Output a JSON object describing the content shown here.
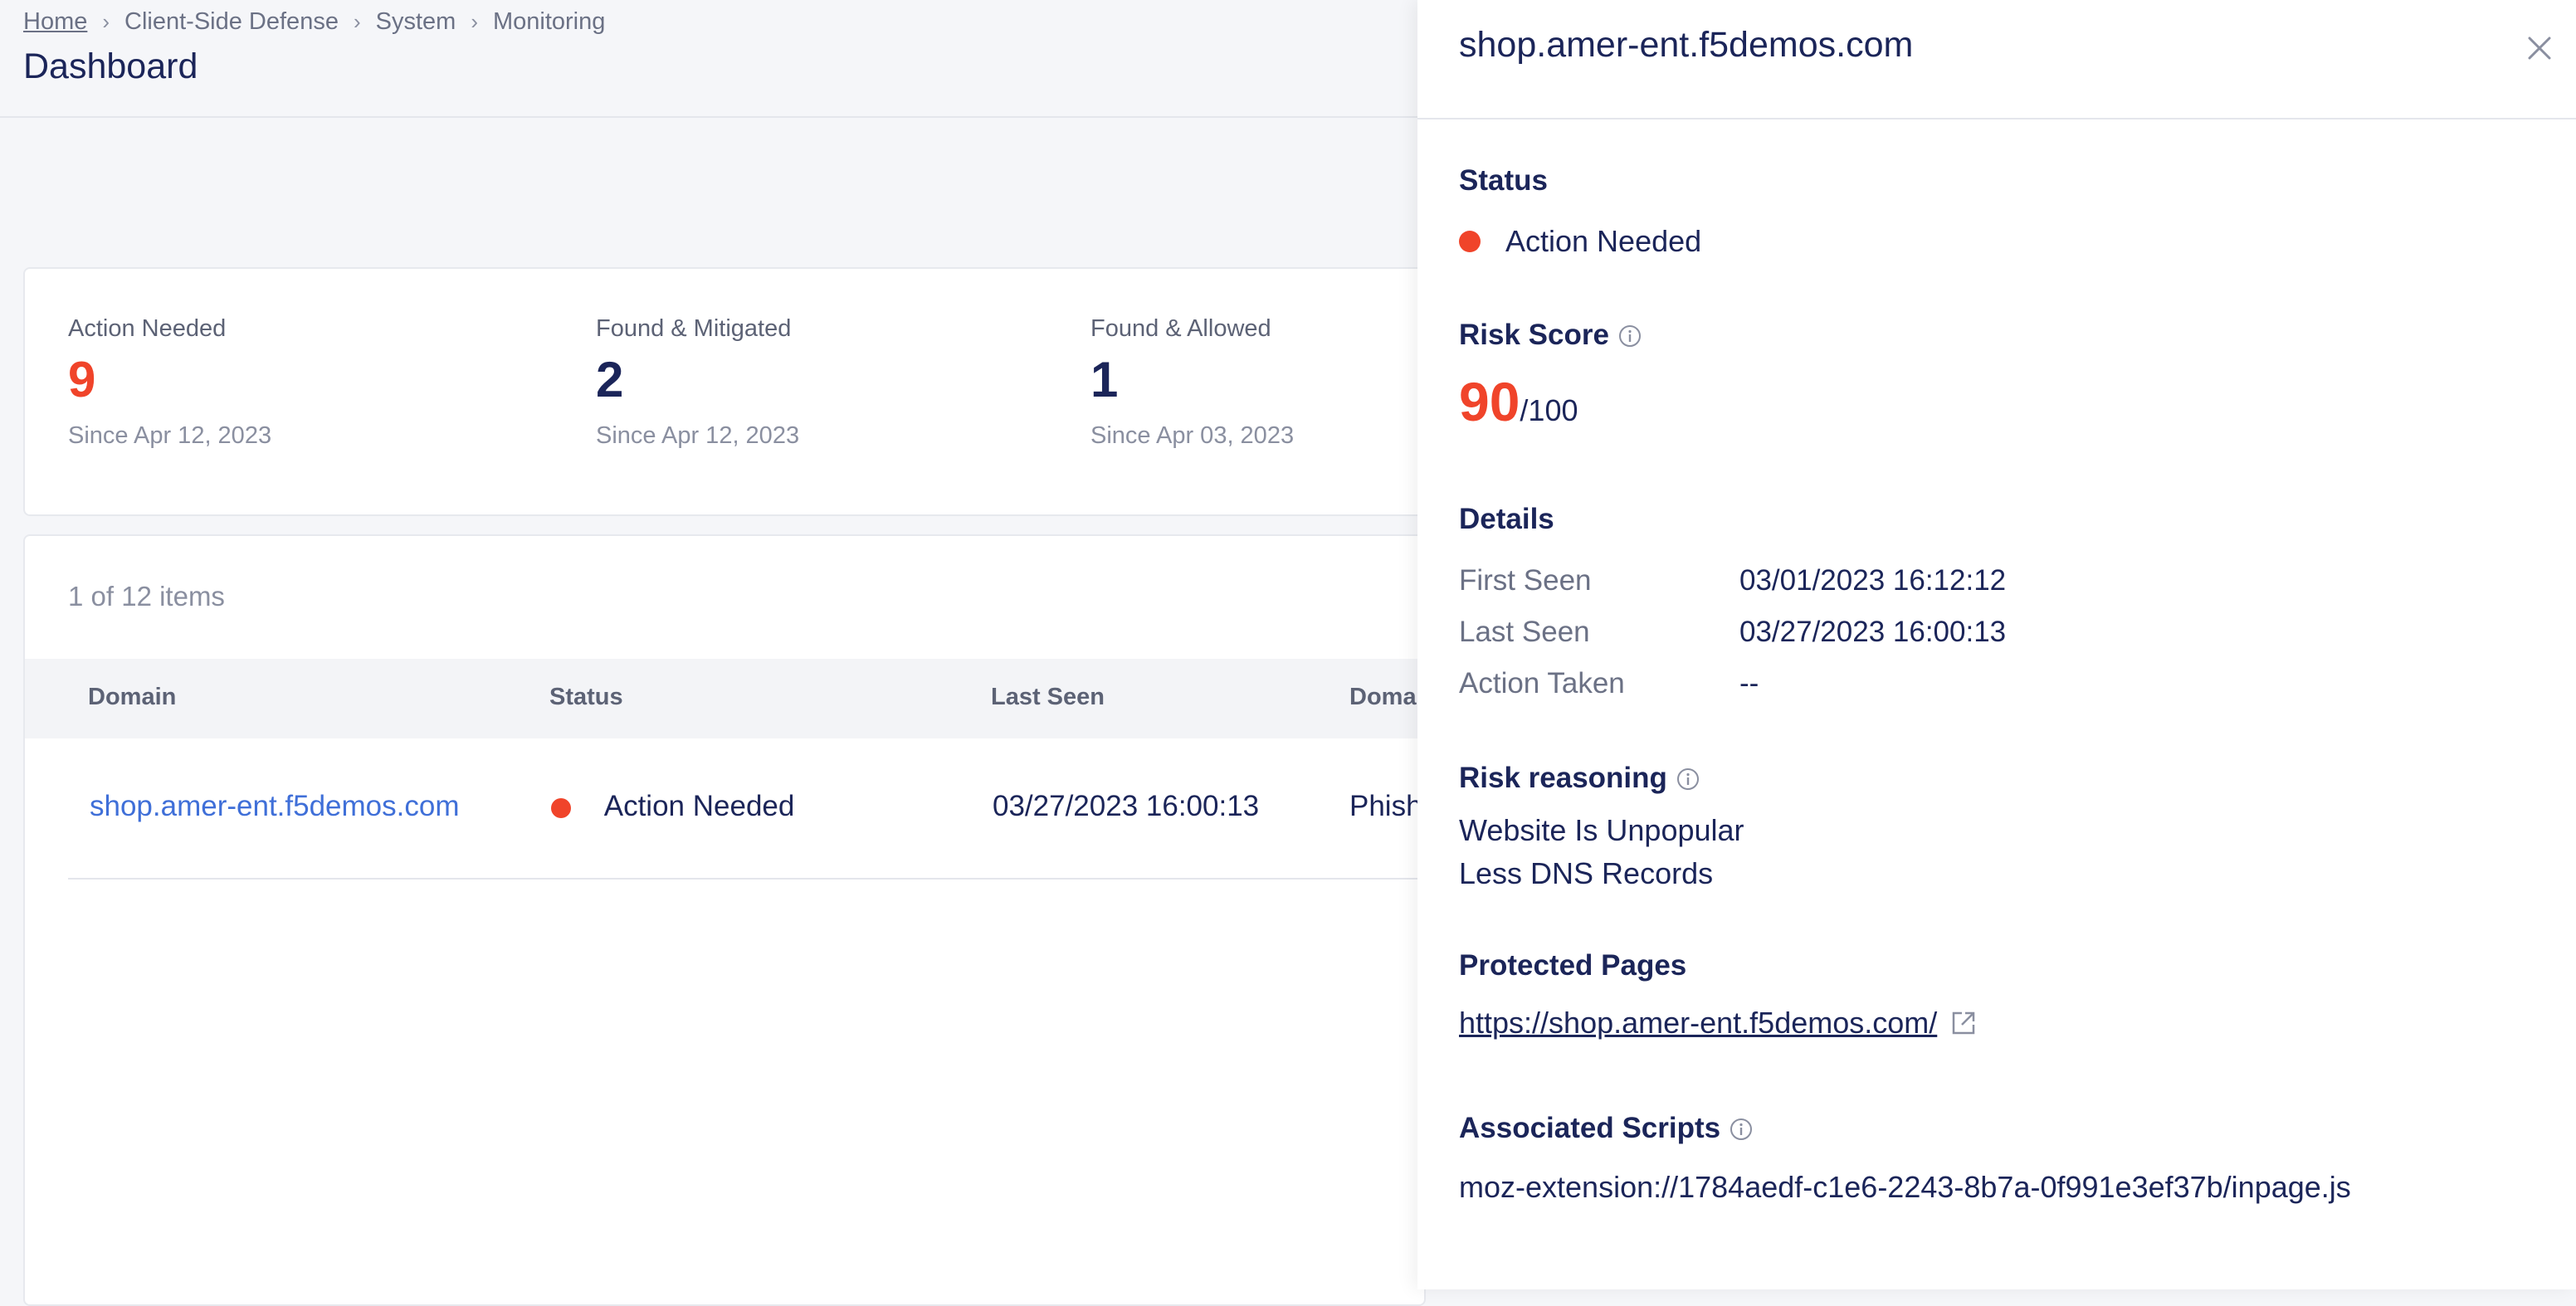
{
  "breadcrumb": [
    "Home",
    "Client-Side Defense",
    "System",
    "Monitoring"
  ],
  "page_title": "Dashboard",
  "stats": [
    {
      "label": "Action Needed",
      "value": "9",
      "since": "Since Apr 12, 2023"
    },
    {
      "label": "Found & Mitigated",
      "value": "2",
      "since": "Since Apr 12, 2023"
    },
    {
      "label": "Found & Allowed",
      "value": "1",
      "since": "Since Apr 03, 2023"
    }
  ],
  "table": {
    "count_text": "1 of 12 items",
    "headers": [
      "Domain",
      "Status",
      "Last Seen",
      "Doma"
    ],
    "rows": [
      {
        "domain": "shop.amer-ent.f5demos.com",
        "status": "Action Needed",
        "last_seen": "03/27/2023 16:00:13",
        "extra": "Phish"
      }
    ]
  },
  "drawer": {
    "title": "shop.amer-ent.f5demos.com",
    "status_heading": "Status",
    "status_value": "Action Needed",
    "risk_heading": "Risk Score",
    "risk_score": "90",
    "risk_max": "/100",
    "details_heading": "Details",
    "details": [
      {
        "label": "First Seen",
        "value": "03/01/2023 16:12:12"
      },
      {
        "label": "Last Seen",
        "value": "03/27/2023 16:00:13"
      },
      {
        "label": "Action Taken",
        "value": "--"
      }
    ],
    "reasoning_heading": "Risk reasoning",
    "reasoning": [
      "Website Is Unpopular",
      "Less DNS Records"
    ],
    "protected_heading": "Protected Pages",
    "protected_page": "https://shop.amer-ent.f5demos.com/",
    "scripts_heading": "Associated Scripts",
    "script": "moz-extension://1784aedf-c1e6-2243-8b7a-0f991e3ef37b/inpage.js"
  },
  "colors": {
    "accent_red": "#f0442a",
    "navy": "#1b2559",
    "link_blue": "#3f6fd8"
  },
  "icons": [
    "chevron-right-icon",
    "close-icon",
    "info-icon",
    "external-link-icon",
    "status-dot-icon"
  ]
}
